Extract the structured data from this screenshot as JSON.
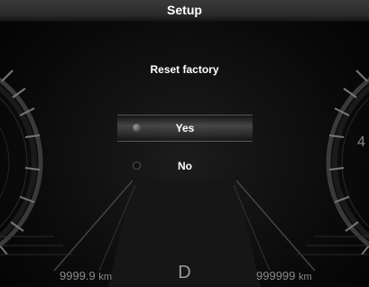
{
  "header": {
    "title": "Setup"
  },
  "menu": {
    "title": "Reset factory",
    "options": [
      {
        "label": "Yes",
        "selected": true
      },
      {
        "label": "No",
        "selected": false
      }
    ]
  },
  "footer": {
    "trip": {
      "value": "9999.9",
      "unit": "km"
    },
    "gear": "D",
    "odometer": {
      "value": "999999",
      "unit": "km"
    }
  },
  "colors": {
    "text": "#ffffff",
    "dim_text": "#8a8a8a",
    "background": "#0b0b0b"
  }
}
